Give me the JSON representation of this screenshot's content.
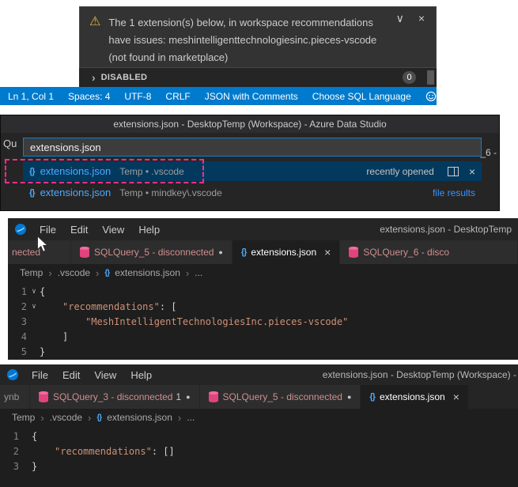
{
  "icons": {
    "warning": "⚠",
    "chevron_down": "∨",
    "close": "×",
    "braces": "{}",
    "breadcrumb_sep": "›",
    "section_chevron": "›",
    "dirty_dot": "●",
    "fold": "∨",
    "more": "..."
  },
  "colors": {
    "statusbar_blue": "#007acc",
    "accent_blue": "#3794ff",
    "selection_blue": "#04395e",
    "warning_yellow": "#e2b73d",
    "json_string_orange": "#ce9178",
    "db_icon_pink": "#e1447c",
    "annotation_pink": "#ff2d8a"
  },
  "notification": {
    "line1": "The 1 extension(s) below, in workspace recommendations",
    "line2": "have issues: meshintelligenttechnologiesinc.pieces-vscode",
    "line3": "(not found in marketplace)"
  },
  "extensions_section": {
    "label": "DISABLED",
    "badge": "0"
  },
  "statusbar": {
    "cursor_position": "Ln 1, Col 1",
    "indentation": "Spaces: 4",
    "encoding": "UTF-8",
    "eol": "CRLF",
    "language_mode": "JSON with Comments",
    "sql_language": "Choose SQL Language"
  },
  "quickopen": {
    "window_title": "extensions.json - DesktopTemp (Workspace) - Azure Data Studio",
    "left_fragment": "Qu",
    "right_fragment": "/_6 -",
    "input_value": "extensions.json",
    "results": [
      {
        "name": "extensions.json",
        "detail": "Temp • .vscode",
        "group": "recently opened"
      },
      {
        "name": "extensions.json",
        "detail": "Temp • mindkey\\.vscode",
        "group": "file results"
      }
    ]
  },
  "window_a": {
    "menu": [
      "File",
      "Edit",
      "View",
      "Help"
    ],
    "title": "extensions.json - DesktopTemp",
    "tabs": {
      "partial_left": "nected",
      "sql_tab": "SQLQuery_5 - disconnected",
      "active_file": "extensions.json",
      "partial_right": "SQLQuery_6 - disco"
    },
    "breadcrumb": {
      "root": "Temp",
      "folder": ".vscode",
      "file": "extensions.json"
    },
    "editor": {
      "line_numbers": [
        "1",
        "2",
        "3",
        "4",
        "5"
      ],
      "line1": "{",
      "line2_key": "\"recommendations\"",
      "line2_punct": ": [",
      "line3_string": "\"MeshIntelligentTechnologiesInc.pieces-vscode\"",
      "line4": "]",
      "line5": "}"
    }
  },
  "window_b": {
    "menu": [
      "File",
      "Edit",
      "View",
      "Help"
    ],
    "title": "extensions.json - DesktopTemp (Workspace) -",
    "tabs": {
      "partial_left": "ynb",
      "sql_tab1": "SQLQuery_3 - disconnected",
      "sql_tab1_suffix": "1",
      "sql_tab2": "SQLQuery_5 - disconnected",
      "active_file": "extensions.json"
    },
    "breadcrumb": {
      "root": "Temp",
      "folder": ".vscode",
      "file": "extensions.json"
    },
    "editor": {
      "line_numbers": [
        "1",
        "2",
        "3"
      ],
      "line1": "{",
      "line2_key": "\"recommendations\"",
      "line2_punct": ": []",
      "line3": "}"
    }
  }
}
